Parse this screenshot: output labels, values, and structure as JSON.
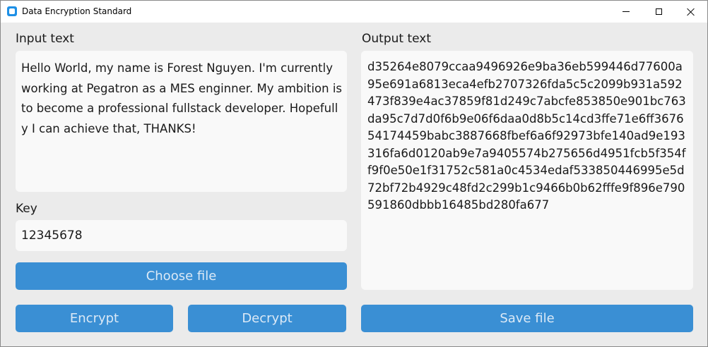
{
  "window": {
    "title": "Data Encryption Standard"
  },
  "input": {
    "label": "Input text",
    "value": "Hello World, my name is Forest Nguyen. I'm currently working at Pegatron as a MES enginner. My ambition is to become a professional fullstack developer. Hopefully I can achieve that, THANKS!"
  },
  "key": {
    "label": "Key",
    "value": "12345678"
  },
  "output": {
    "label": "Output text",
    "value": "d35264e8079ccaa9496926e9ba36eb599446d77600a95e691a6813eca4efb2707326fda5c5c2099b931a592473f839e4ac37859f81d249c7abcfe853850e901bc763da95c7d7d0f6b9e06f6daa0d8b5c14cd3ffe71e6ff367654174459babc3887668fbef6a6f92973bfe140ad9e193316fa6d0120ab9e7a9405574b275656d4951fcb5f354ff9f0e50e1f31752c581a0c4534edaf533850446995e5d72bf72b4929c48fd2c299b1c9466b0b62fffe9f896e790591860dbbb16485bd280fa677"
  },
  "buttons": {
    "choose_file": "Choose file",
    "encrypt": "Encrypt",
    "decrypt": "Decrypt",
    "save_file": "Save file"
  },
  "icons": {
    "app": "app-icon",
    "minimize": "minimize-icon",
    "maximize": "maximize-icon",
    "close": "close-icon"
  },
  "colors": {
    "accent": "#3a8fd4",
    "background": "#ebebeb",
    "field": "#f9f9f9"
  }
}
